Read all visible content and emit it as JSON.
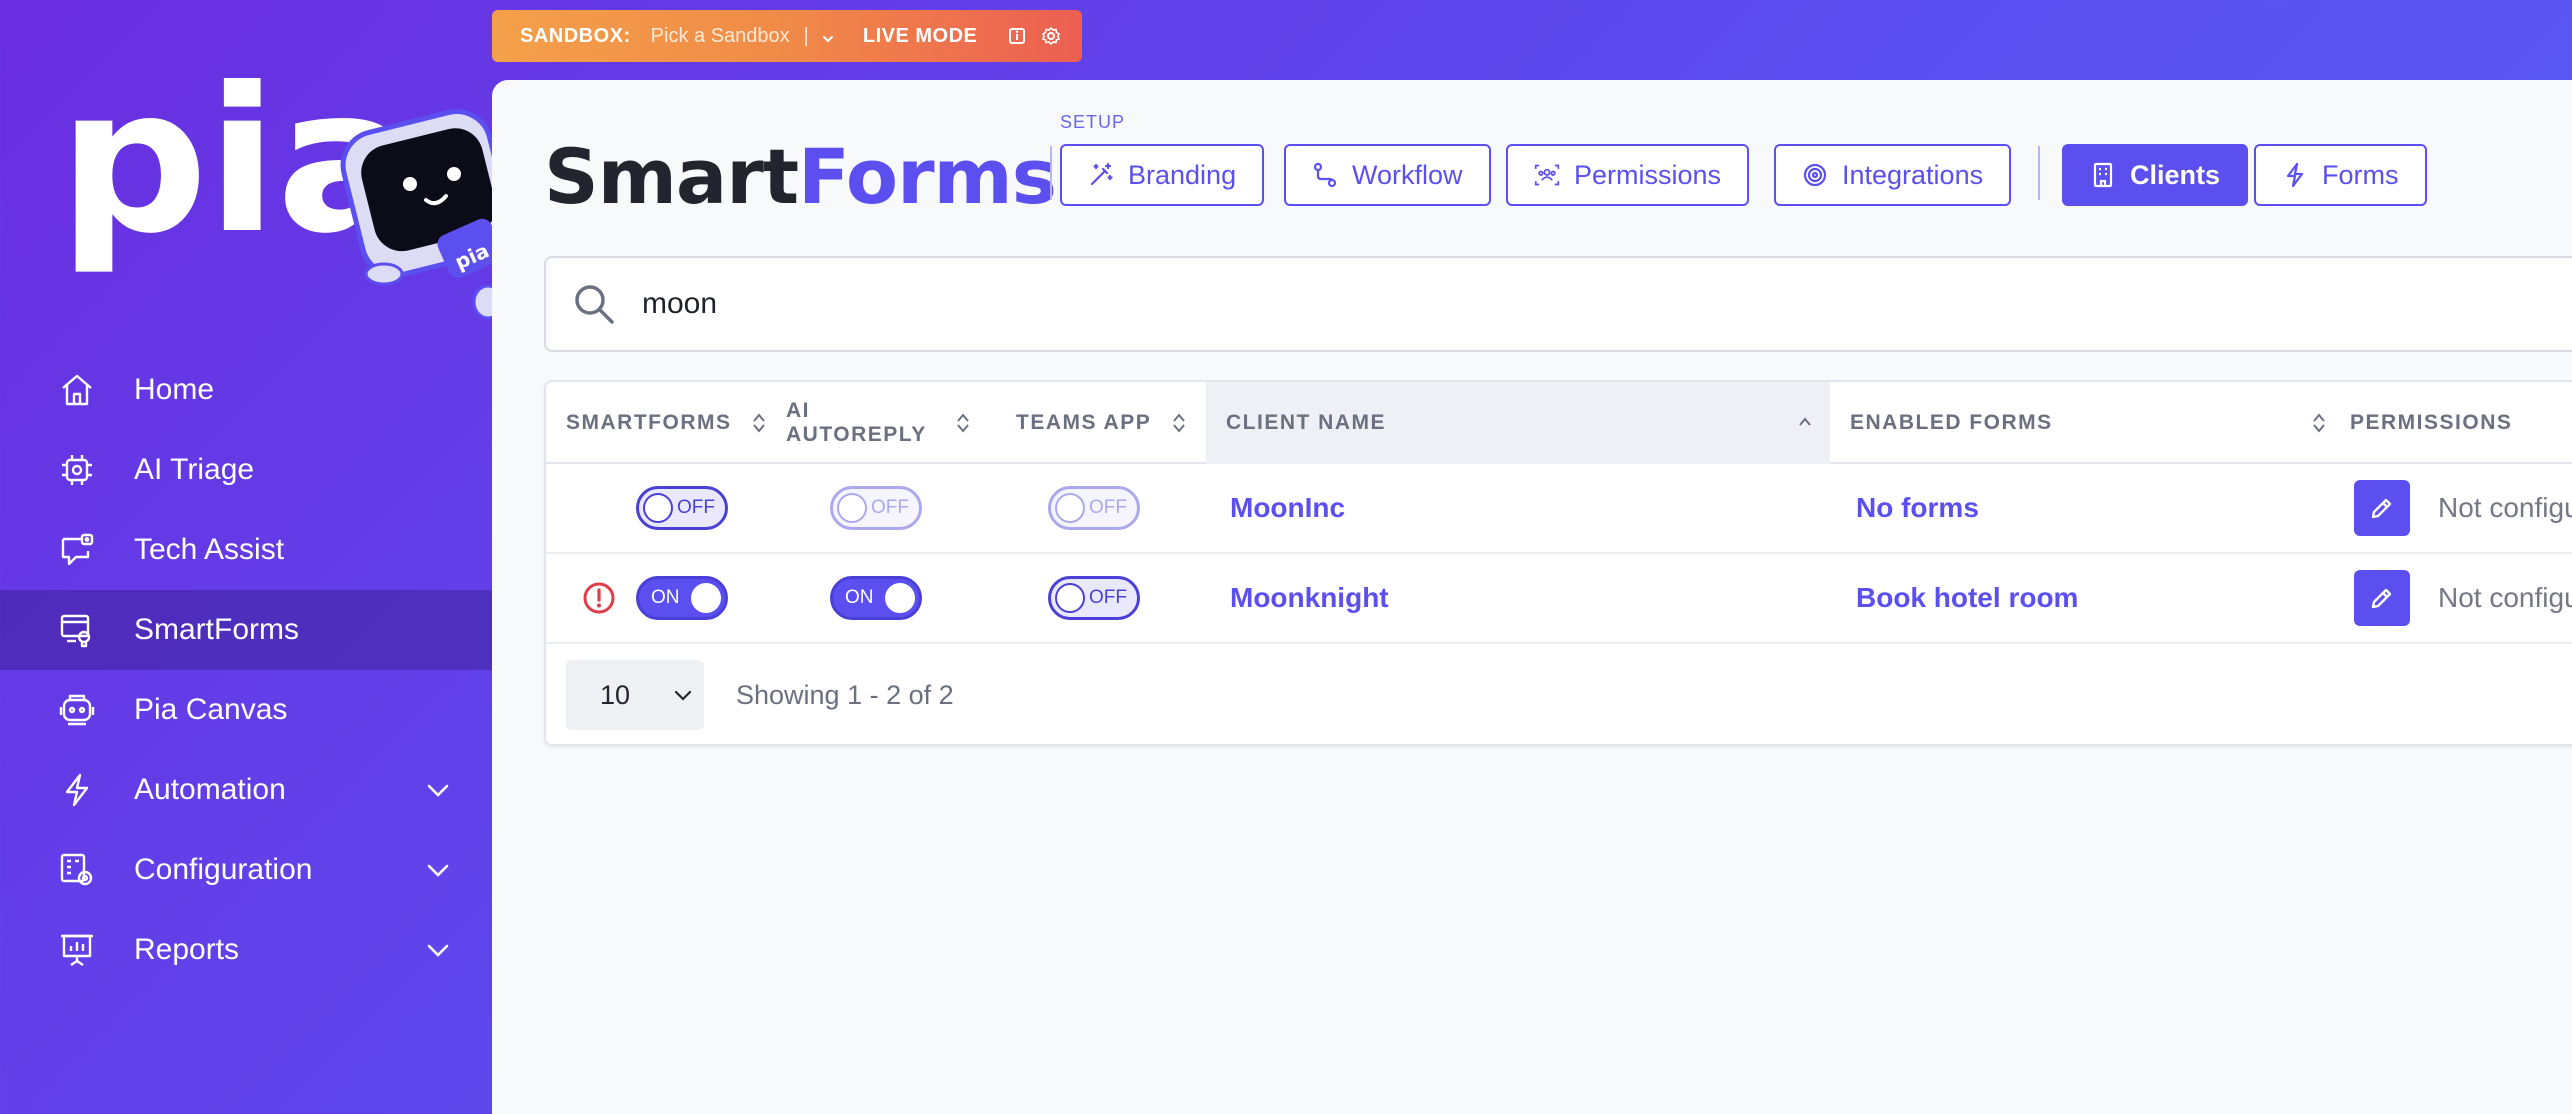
{
  "sandbox": {
    "label": "SANDBOX:",
    "picker": "Pick a Sandbox",
    "separator": "|",
    "mode": "LIVE MODE"
  },
  "brand": {
    "logo": "pia"
  },
  "sidebar": {
    "items": [
      {
        "label": "Home",
        "icon": "home-icon"
      },
      {
        "label": "AI Triage",
        "icon": "cpu-icon"
      },
      {
        "label": "Tech Assist",
        "icon": "chat-bot-icon"
      },
      {
        "label": "SmartForms",
        "icon": "form-icon",
        "active": true
      },
      {
        "label": "Pia Canvas",
        "icon": "canvas-icon"
      },
      {
        "label": "Automation",
        "icon": "bolt-icon",
        "expandable": true
      },
      {
        "label": "Configuration",
        "icon": "config-icon",
        "expandable": true
      },
      {
        "label": "Reports",
        "icon": "presentation-icon",
        "expandable": true
      }
    ]
  },
  "header": {
    "title_part1": "Smart",
    "title_part2": "Forms",
    "setup_label": "SETUP",
    "tabs": [
      {
        "label": "Branding",
        "icon": "magic-wand-icon"
      },
      {
        "label": "Workflow",
        "icon": "route-icon"
      },
      {
        "label": "Permissions",
        "icon": "users-icon"
      },
      {
        "label": "Integrations",
        "icon": "target-icon"
      },
      {
        "label": "Clients",
        "icon": "building-icon",
        "active": true
      },
      {
        "label": "Forms",
        "icon": "bolt-icon"
      }
    ]
  },
  "search": {
    "value": "moon"
  },
  "table": {
    "columns": [
      "SMARTFORMS",
      "AI AUTOREPLY",
      "TEAMS APP",
      "CLIENT NAME",
      "ENABLED FORMS",
      "PERMISSIONS"
    ],
    "rows": [
      {
        "warning": false,
        "smartforms": "OFF",
        "autoreply": "OFF",
        "teams": "OFF",
        "client_name": "MoonInc",
        "enabled_forms": "No forms",
        "permissions": "Not configured"
      },
      {
        "warning": true,
        "smartforms": "ON",
        "autoreply": "ON",
        "teams": "OFF",
        "client_name": "Moonknight",
        "enabled_forms": "Book hotel room",
        "permissions": "Not configured"
      }
    ]
  },
  "pagination": {
    "page_size": "10",
    "info": "Showing 1 - 2 of 2"
  },
  "colors": {
    "accent": "#5b4ff0",
    "sidebar_start": "#6a2ee0",
    "banner_start": "#f4a04a",
    "banner_end": "#ec5f52",
    "warning": "#e03c4a"
  }
}
